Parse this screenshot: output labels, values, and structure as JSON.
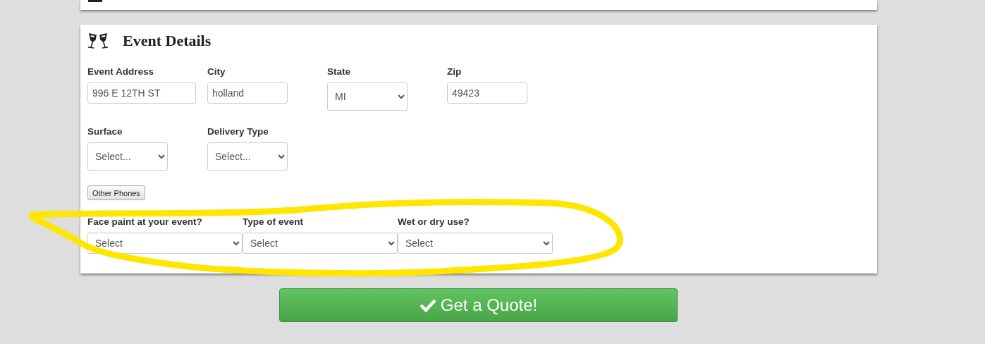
{
  "section": {
    "title": "Event Details"
  },
  "rows": [
    {
      "fields": [
        {
          "label": "Event Address",
          "kind": "text",
          "value": "996 E 12TH ST"
        },
        {
          "label": "City",
          "kind": "text",
          "value": "holland"
        },
        {
          "label": "State",
          "kind": "select",
          "value": "MI"
        },
        {
          "label": "Zip",
          "kind": "text",
          "value": "49423"
        }
      ]
    },
    {
      "fields": [
        {
          "label": "Surface",
          "kind": "select",
          "value": "Select..."
        },
        {
          "label": "Delivery Type",
          "kind": "select",
          "value": "Select..."
        }
      ]
    },
    {
      "button": "Other Phones"
    },
    {
      "kind": "strip",
      "fields": [
        {
          "label": "Face paint at your event?",
          "kind": "select",
          "value": "Select"
        },
        {
          "label": "Type of event",
          "kind": "select",
          "value": "Select"
        },
        {
          "label": "Wet or dry use?",
          "kind": "select",
          "value": "Select"
        }
      ]
    }
  ],
  "submit": {
    "label": "Get a Quote!"
  },
  "annotation": {
    "kind": "scribble"
  }
}
